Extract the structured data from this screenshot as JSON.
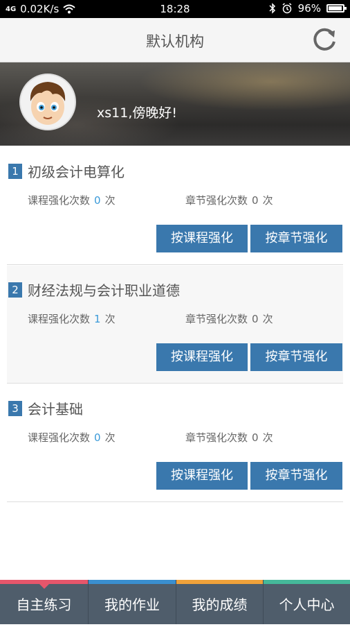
{
  "status_bar": {
    "signal": "4G",
    "speed": "0.02K/s",
    "time": "18:28",
    "battery": "96%",
    "battery_level": 0.96
  },
  "title_bar": {
    "title": "默认机构",
    "refresh_icon": "refresh-icon"
  },
  "banner": {
    "greeting": "xs11,傍晚好!"
  },
  "courses": [
    {
      "num": "1",
      "name": "初级会计电算化",
      "course_label": "课程强化次数",
      "course_count": "0",
      "chapter_label": "章节强化次数",
      "chapter_count": "0",
      "unit": "次",
      "btn_course": "按课程强化",
      "btn_chapter": "按章节强化"
    },
    {
      "num": "2",
      "name": "财经法规与会计职业道德",
      "course_label": "课程强化次数",
      "course_count": "1",
      "chapter_label": "章节强化次数",
      "chapter_count": "0",
      "unit": "次",
      "btn_course": "按课程强化",
      "btn_chapter": "按章节强化"
    },
    {
      "num": "3",
      "name": "会计基础",
      "course_label": "课程强化次数",
      "course_count": "0",
      "chapter_label": "章节强化次数",
      "chapter_count": "0",
      "unit": "次",
      "btn_course": "按课程强化",
      "btn_chapter": "按章节强化"
    }
  ],
  "tabs": [
    {
      "label": "自主练习",
      "color": "#e6566b",
      "active": true
    },
    {
      "label": "我的作业",
      "color": "#3a8fcf",
      "active": false
    },
    {
      "label": "我的成绩",
      "color": "#f0a23a",
      "active": false
    },
    {
      "label": "个人中心",
      "color": "#45b89a",
      "active": false
    }
  ],
  "colors": {
    "accent": "#3a78ad",
    "count_highlight": "#3a9ad9",
    "tabbar_bg": "#4f5d6b"
  }
}
